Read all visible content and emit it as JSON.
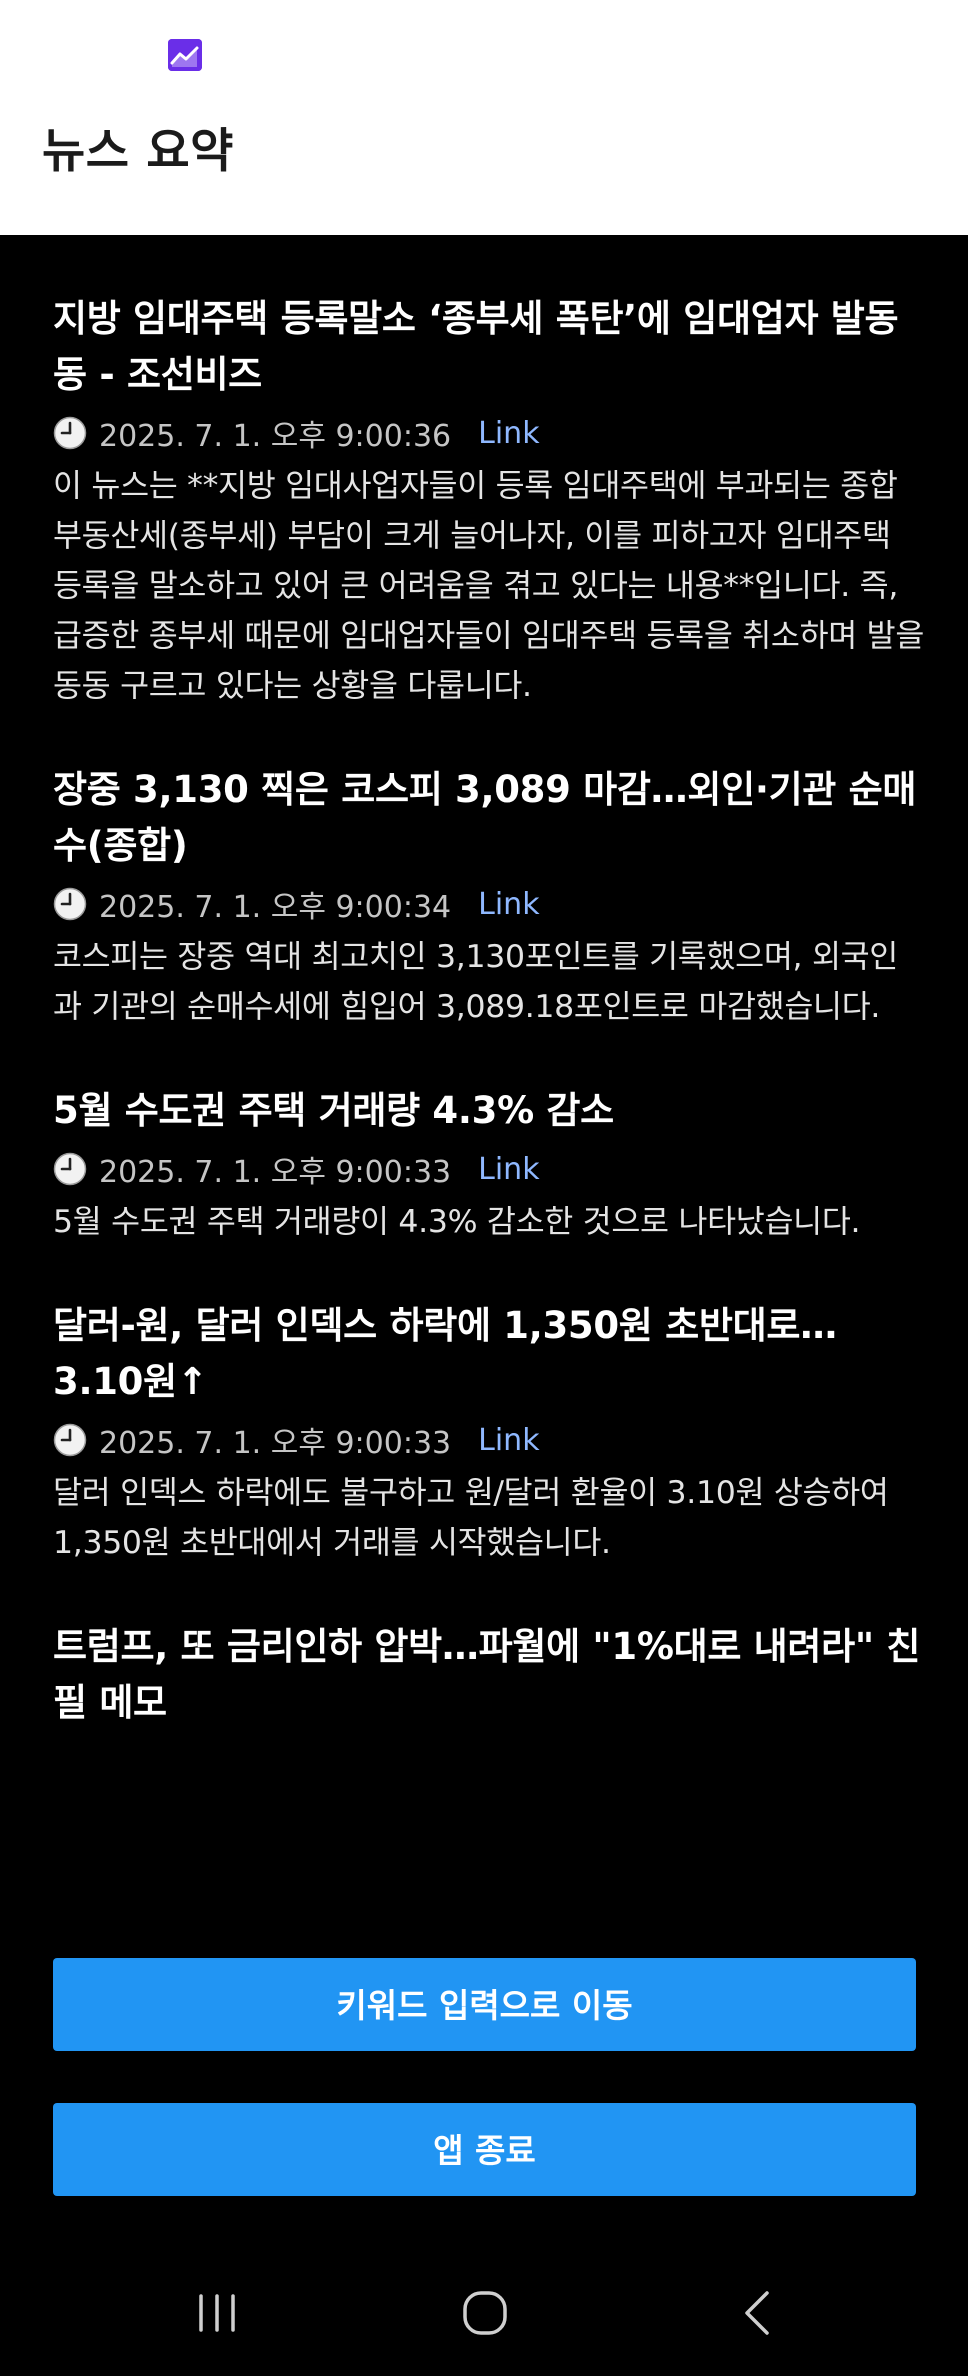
{
  "header": {
    "title": "뉴스 요약",
    "app_icon": "chart-trend-icon",
    "accent_color": "#6a2ee8"
  },
  "news": [
    {
      "title": "지방 임대주택 등록말소 ‘종부세 폭탄’에 임대업자 발동동 - 조선비즈",
      "time": "2025. 7. 1. 오후 9:00:36",
      "link_label": "Link",
      "summary": "이 뉴스는 **지방 임대사업자들이 등록 임대주택에 부과되는 종합부동산세(종부세) 부담이 크게 늘어나자, 이를 피하고자 임대주택 등록을 말소하고 있어 큰 어려움을 겪고 있다는 내용**입니다. 즉, 급증한 종부세 때문에 임대업자들이 임대주택 등록을 취소하며 발을 동동 구르고 있다는 상황을 다룹니다."
    },
    {
      "title": "장중 3,130 찍은 코스피 3,089 마감…외인·기관 순매수(종합)",
      "time": "2025. 7. 1. 오후 9:00:34",
      "link_label": "Link",
      "summary": "코스피는 장중 역대 최고치인 3,130포인트를 기록했으며, 외국인과 기관의 순매수세에 힘입어 3,089.18포인트로 마감했습니다."
    },
    {
      "title": "5월 수도권 주택 거래량 4.3% 감소",
      "time": "2025. 7. 1. 오후 9:00:33",
      "link_label": "Link",
      "summary": "5월 수도권 주택 거래량이 4.3% 감소한 것으로 나타났습니다."
    },
    {
      "title": "달러-원, 달러 인덱스 하락에 1,350원 초반대로… 3.10원↑",
      "time": "2025. 7. 1. 오후 9:00:33",
      "link_label": "Link",
      "summary": "달러 인덱스 하락에도 불구하고 원/달러 환율이 3.10원 상승하여 1,350원 초반대에서 거래를 시작했습니다."
    },
    {
      "title": "트럼프, 또 금리인하 압박…파월에 \"1%대로 내려라\" 친필 메모",
      "time": "",
      "link_label": "",
      "summary": ""
    }
  ],
  "buttons": {
    "keyword_label": "키워드 입력으로 이동",
    "exit_label": "앱 종료",
    "color": "#2195f3"
  },
  "navbar": {
    "recent_icon": "recent-apps-icon",
    "home_icon": "home-icon",
    "back_icon": "back-icon"
  }
}
